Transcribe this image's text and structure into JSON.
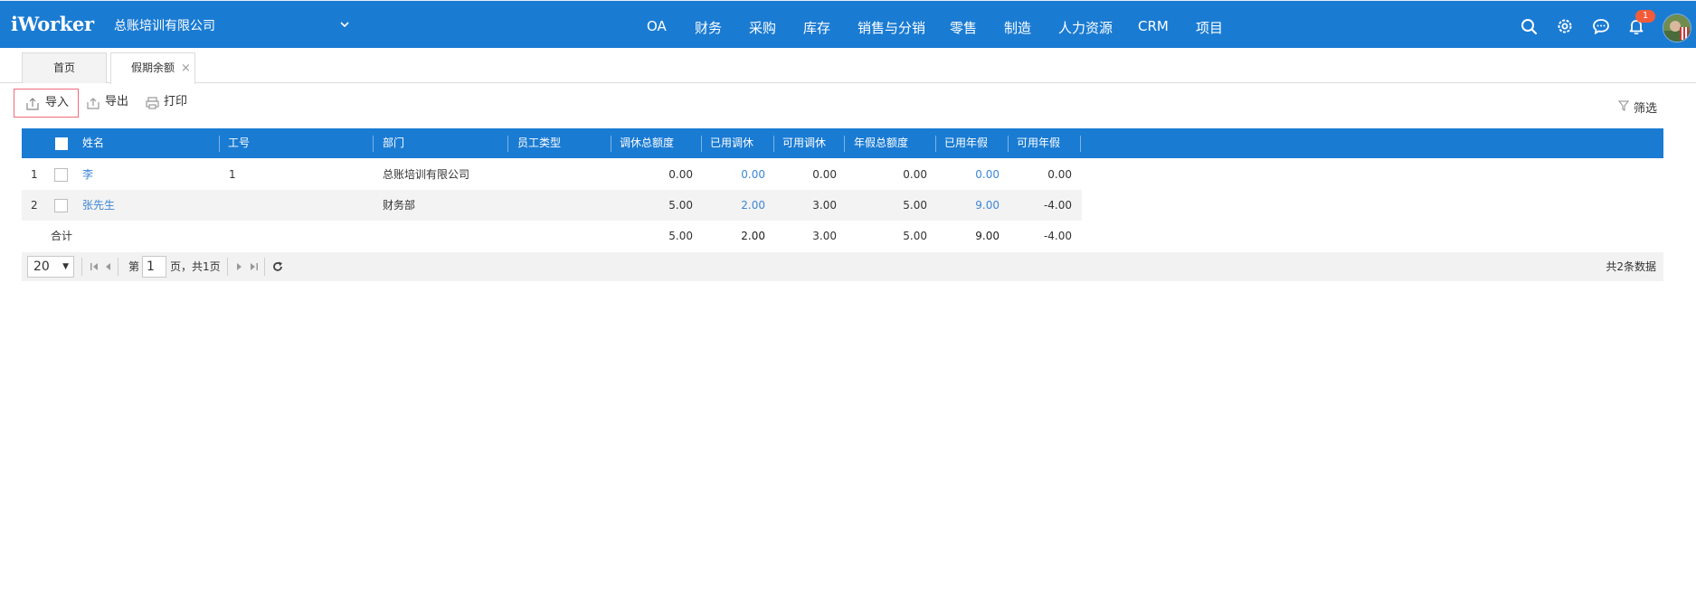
{
  "app": {
    "logo": "iWorker",
    "company": "总账培训有限公司",
    "nav": [
      "OA",
      "财务",
      "采购",
      "库存",
      "销售与分销",
      "零售",
      "制造",
      "人力资源",
      "CRM",
      "项目"
    ],
    "notification_count": "1",
    "accent_color": "#1a7bd3"
  },
  "tabs": [
    {
      "label": "首页"
    },
    {
      "label": "假期余额",
      "close": "×"
    }
  ],
  "toolbar": {
    "import_label": "导入",
    "export_label": "导出",
    "print_label": "打印",
    "filter_label": "筛选"
  },
  "table": {
    "columns": [
      "姓名",
      "工号",
      "部门",
      "员工类型",
      "调休总额度",
      "已用调休",
      "可用调休",
      "年假总额度",
      "已用年假",
      "可用年假"
    ],
    "rows": [
      {
        "index": "1",
        "name": "李",
        "emp_no": "1",
        "dept": "总账培训有限公司",
        "emp_type": "",
        "comp_total": "0.00",
        "comp_used": "0.00",
        "comp_avail": "0.00",
        "annual_total": "0.00",
        "annual_used": "0.00",
        "annual_avail": "0.00"
      },
      {
        "index": "2",
        "name": "张先生",
        "emp_no": "",
        "dept": "财务部",
        "emp_type": "",
        "comp_total": "5.00",
        "comp_used": "2.00",
        "comp_avail": "3.00",
        "annual_total": "5.00",
        "annual_used": "9.00",
        "annual_avail": "-4.00"
      }
    ],
    "total": {
      "label": "合计",
      "comp_total": "5.00",
      "comp_used": "2.00",
      "comp_avail": "3.00",
      "annual_total": "5.00",
      "annual_used": "9.00",
      "annual_avail": "-4.00"
    }
  },
  "pager": {
    "page_size": "20",
    "page_prefix": "第",
    "page_number": "1",
    "page_suffix": "页，共1页",
    "total_records": "共2条数据"
  }
}
